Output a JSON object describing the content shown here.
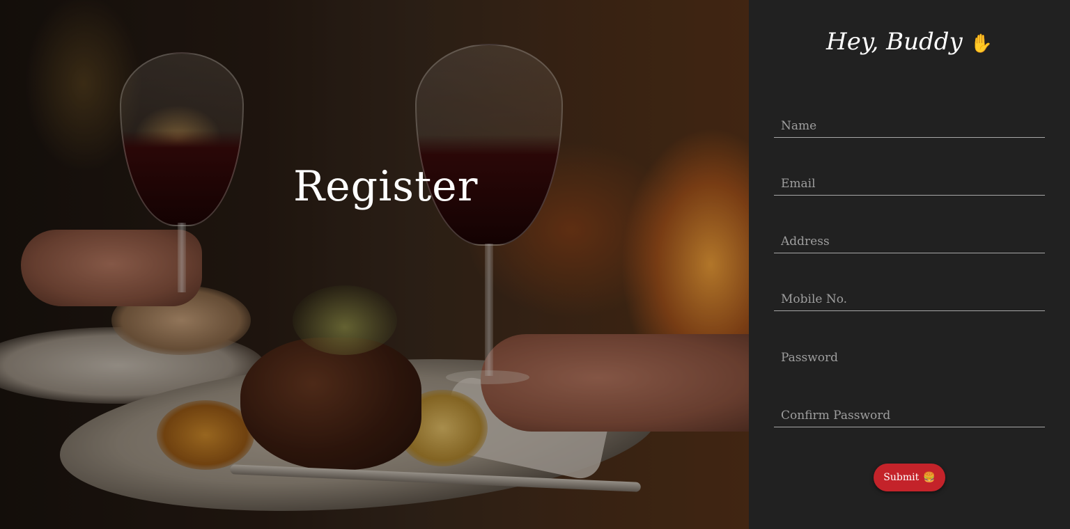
{
  "hero": {
    "title": "Register",
    "background_image": "restaurant-dinner-photo"
  },
  "form": {
    "greeting": "Hey, Buddy",
    "greeting_icon": "✋",
    "fields": [
      {
        "placeholder": "Name",
        "value": ""
      },
      {
        "placeholder": "Email",
        "value": ""
      },
      {
        "placeholder": "Address",
        "value": ""
      },
      {
        "placeholder": "Mobile No.",
        "value": ""
      },
      {
        "placeholder": "Password",
        "value": ""
      },
      {
        "placeholder": "Confirm Password",
        "value": ""
      }
    ],
    "submit_label": "Submit",
    "submit_icon": "🍔"
  },
  "colors": {
    "panel_bg": "#212121",
    "accent": "#c4232a",
    "text": "#ffffff",
    "placeholder": "#9e9e9e",
    "underline": "#a8a8a8"
  }
}
